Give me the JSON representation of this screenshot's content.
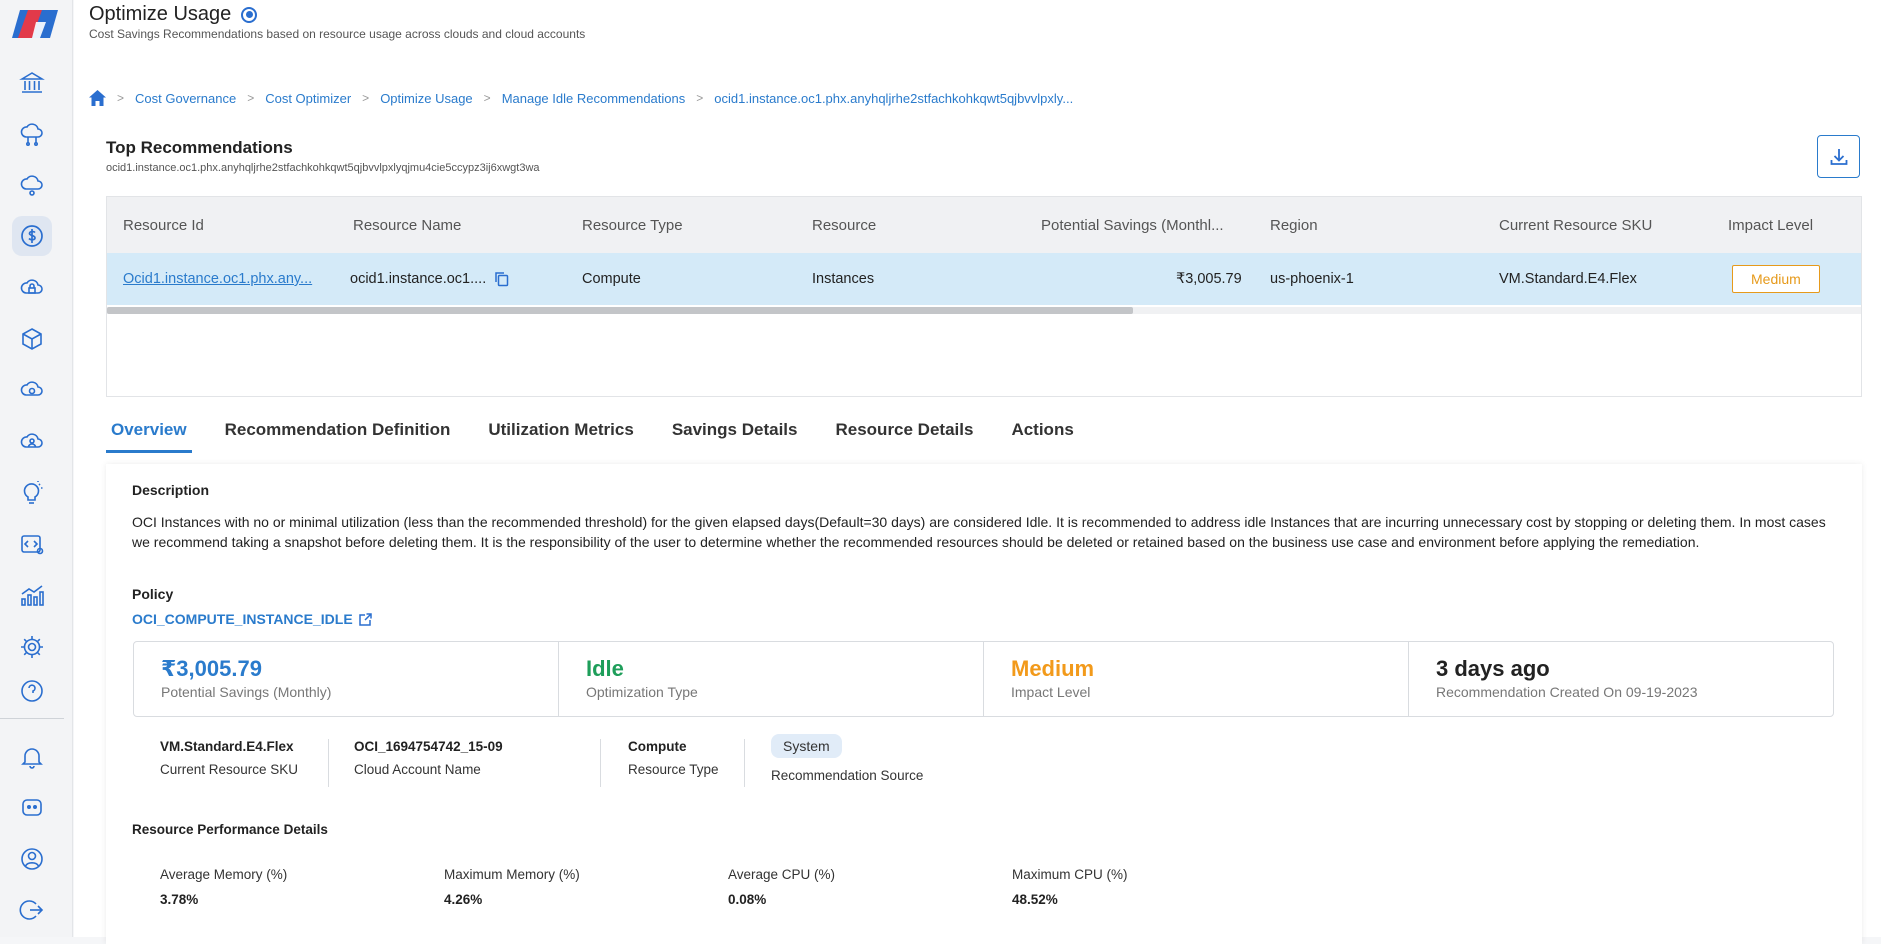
{
  "header": {
    "title": "Optimize Usage",
    "subtitle": "Cost Savings Recommendations based on resource usage across clouds and cloud accounts"
  },
  "breadcrumb": [
    "Cost Governance",
    "Cost Optimizer",
    "Optimize Usage",
    "Manage Idle Recommendations",
    "ocid1.instance.oc1.phx.anyhqljrhe2stfachkohkqwt5qjbvvlpxly..."
  ],
  "top_recommendations": {
    "title": "Top Recommendations",
    "resource_ocid": "ocid1.instance.oc1.phx.anyhqljrhe2stfachkohkqwt5qjbvvlpxlyqjmu4cie5ccypz3ij6xwgt3wa"
  },
  "table": {
    "headers": [
      "Resource Id",
      "Resource Name",
      "Resource Type",
      "Resource",
      "Potential Savings (Monthl...",
      "Region",
      "Current Resource SKU",
      "Impact Level"
    ],
    "row": {
      "resource_id": "Ocid1.instance.oc1.phx.any...",
      "resource_name": "ocid1.instance.oc1....",
      "resource_type": "Compute",
      "resource": "Instances",
      "potential_savings": "₹3,005.79",
      "region": "us-phoenix-1",
      "sku": "VM.Standard.E4.Flex",
      "impact_level": "Medium"
    },
    "scroll_fraction": 0.58
  },
  "tabs": [
    "Overview",
    "Recommendation Definition",
    "Utilization Metrics",
    "Savings Details",
    "Resource Details",
    "Actions"
  ],
  "active_tab": "Overview",
  "overview": {
    "description_label": "Description",
    "description": "OCI Instances with no or minimal utilization (less than the recommended threshold) for the given elapsed days(Default=30 days) are considered Idle. It is recommended to address idle Instances that are incurring unnecessary cost by stopping or deleting them. In most cases we recommend taking a snapshot before deleting them. It is the responsibility of the user to determine whether the recommended resources should be deleted or retained based on the business use case and environment before applying the remediation.",
    "policy_label": "Policy",
    "policy_name": "OCI_COMPUTE_INSTANCE_IDLE",
    "stats": [
      {
        "value": "₹3,005.79",
        "label": "Potential Savings (Monthly)",
        "color": "#2a7bcc"
      },
      {
        "value": "Idle",
        "label": "Optimization Type",
        "color": "#1e9e5a"
      },
      {
        "value": "Medium",
        "label": "Impact Level",
        "color": "#f29a1b"
      },
      {
        "value": "3 days ago",
        "label": "Recommendation Created On 09-19-2023",
        "color": "#222222"
      }
    ],
    "meta": {
      "sku": {
        "value": "VM.Standard.E4.Flex",
        "label": "Current Resource SKU"
      },
      "account": {
        "value": "OCI_1694754742_15-09",
        "label": "Cloud Account Name"
      },
      "type": {
        "value": "Compute",
        "label": "Resource Type"
      },
      "source": {
        "value": "System",
        "label": "Recommendation Source"
      }
    },
    "perf_label": "Resource Performance Details",
    "perf": [
      {
        "label": "Average Memory (%)",
        "value": "3.78%"
      },
      {
        "label": "Maximum Memory (%)",
        "value": "4.26%"
      },
      {
        "label": "Average CPU (%)",
        "value": "0.08%"
      },
      {
        "label": "Maximum CPU (%)",
        "value": "48.52%"
      }
    ]
  },
  "colors": {
    "accent": "#2a7bcc",
    "row_highlight": "#d4eaf8",
    "warning": "#f29a1b",
    "success": "#1e9e5a"
  }
}
